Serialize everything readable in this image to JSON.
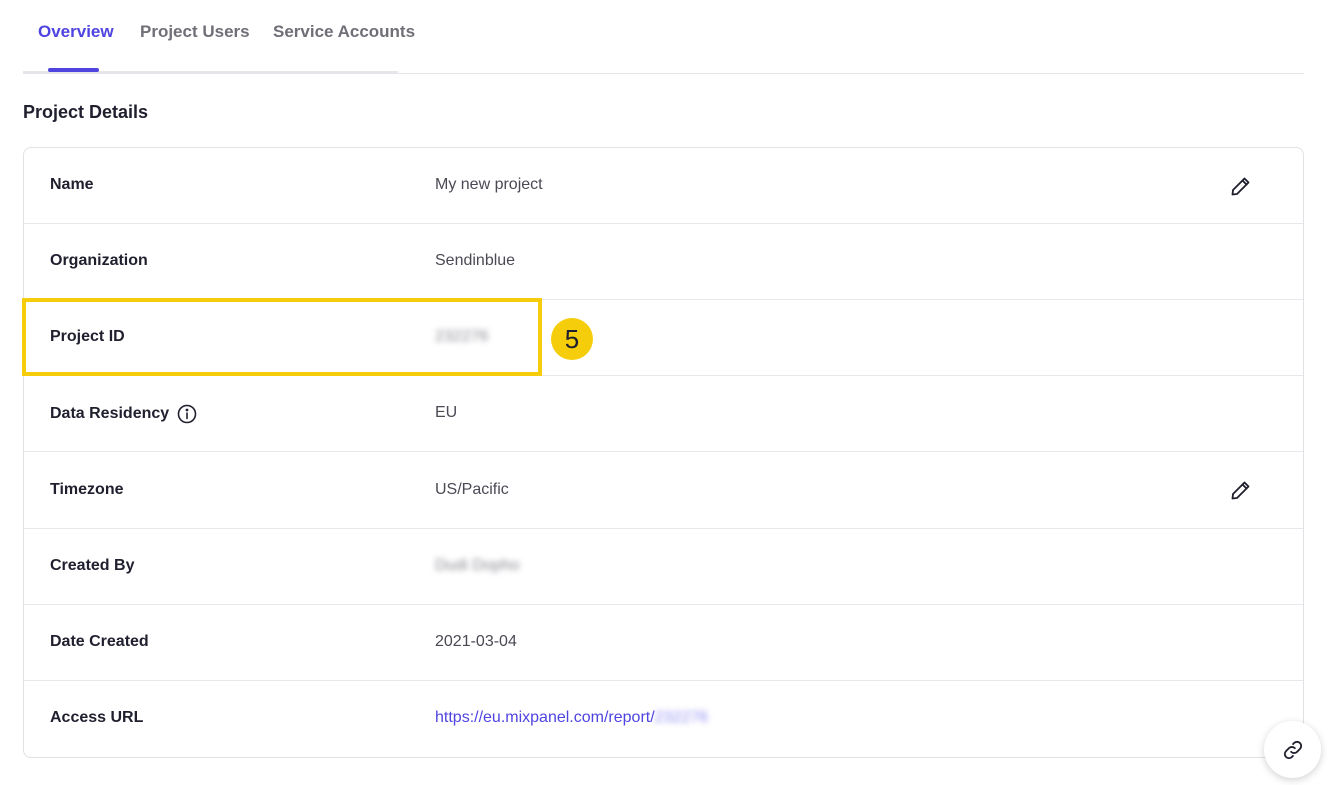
{
  "tabs": [
    {
      "label": "Overview",
      "active": true
    },
    {
      "label": "Project Users",
      "active": false
    },
    {
      "label": "Service Accounts",
      "active": false
    }
  ],
  "section_title": "Project Details",
  "details": {
    "name": {
      "label": "Name",
      "value": "My new project"
    },
    "organization": {
      "label": "Organization",
      "value": "Sendinblue"
    },
    "project_id": {
      "label": "Project ID",
      "value": "232276"
    },
    "data_residency": {
      "label": "Data Residency",
      "value": "EU"
    },
    "timezone": {
      "label": "Timezone",
      "value": "US/Pacific"
    },
    "created_by": {
      "label": "Created By",
      "value": "Dudi Dopho"
    },
    "date_created": {
      "label": "Date Created",
      "value": "2021-03-04"
    },
    "access_url": {
      "label": "Access URL",
      "value": "https://eu.mixpanel.com/report/",
      "value_suffix": "232276"
    }
  },
  "annotation": {
    "badge": "5"
  },
  "icons": {
    "edit": "pencil-icon",
    "info": "info-icon",
    "fab": "link-icon"
  },
  "colors": {
    "accent": "#4f44e0",
    "highlight": "#f5cd0b"
  }
}
